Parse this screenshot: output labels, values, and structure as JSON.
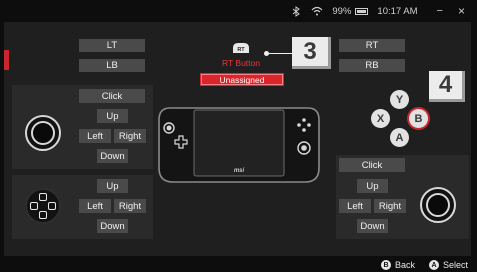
{
  "status": {
    "battery_percent": "99%",
    "time": "10:17 AM",
    "icons": [
      "bluetooth-icon",
      "wifi-icon",
      "battery-icon"
    ],
    "minimize_glyph": "−",
    "close_glyph": "×"
  },
  "left": {
    "lt": "LT",
    "lb": "LB",
    "stick": {
      "click": "Click",
      "up": "Up",
      "left": "Left",
      "right": "Right",
      "down": "Down"
    },
    "dpad": {
      "up": "Up",
      "left": "Left",
      "right": "Right",
      "down": "Down"
    }
  },
  "right": {
    "rt": "RT",
    "rb": "RB",
    "stick": {
      "click": "Click",
      "up": "Up",
      "left": "Left",
      "right": "Right",
      "down": "Down"
    },
    "face_buttons": [
      "Y",
      "X",
      "B",
      "A"
    ]
  },
  "selected": {
    "icon_text": "RT",
    "label": "RT Button",
    "value": "Unassigned"
  },
  "callouts": {
    "a": "3",
    "b": "4"
  },
  "device_logo": "msi",
  "footer": {
    "back_glyph": "B",
    "back": "Back",
    "select_glyph": "A",
    "select": "Select"
  },
  "colors": {
    "accent": "#d9262c",
    "panel": "#1f1f1f",
    "subpanel": "#2a2a2a",
    "button": "#4a4a4a"
  }
}
